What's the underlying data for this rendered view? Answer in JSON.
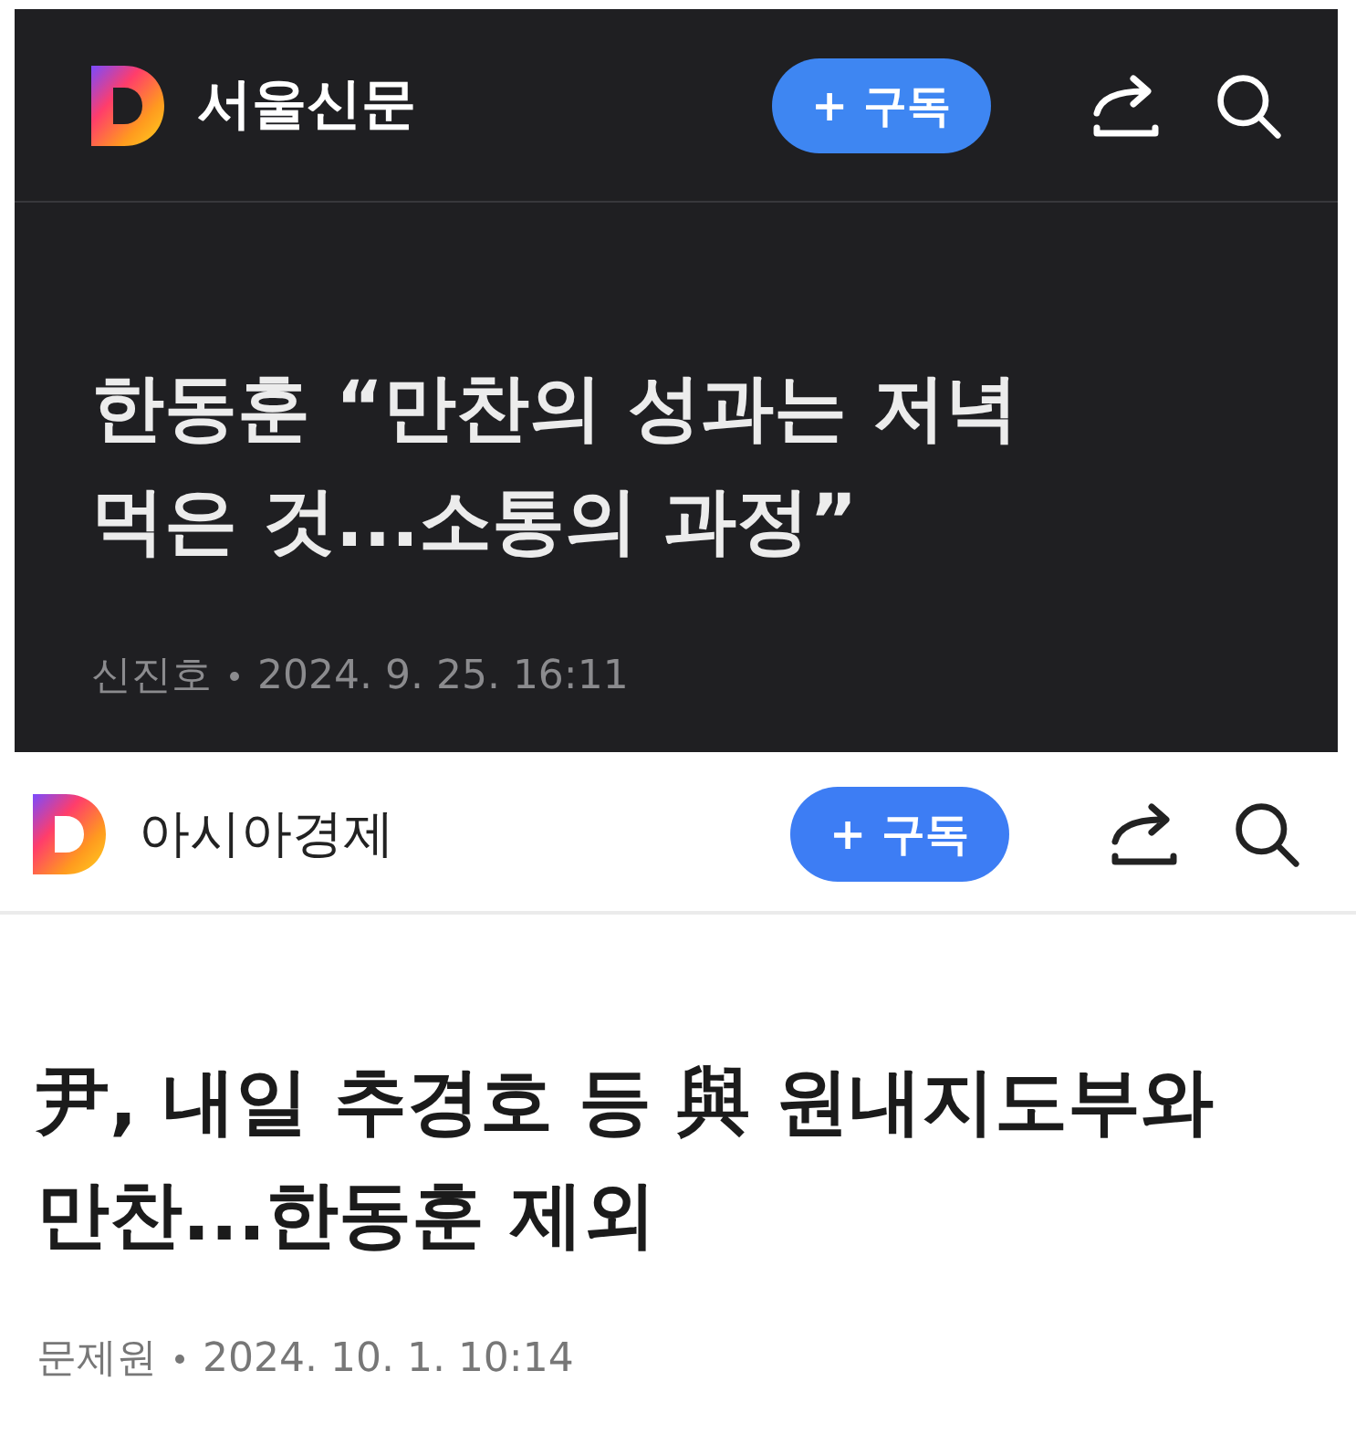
{
  "panels": [
    {
      "dark": true,
      "press": "서울신문",
      "subscribe": "+ 구독",
      "headline_lines": [
        "한동훈 “만찬의 성과는 저녁",
        "먹은 것...소통의 과정”"
      ],
      "author": "신진호",
      "date": "2024. 9. 25. 16:11"
    },
    {
      "dark": false,
      "press": "아시아경제",
      "subscribe": "+ 구독",
      "headline_lines": [
        "尹, 내일 추경호 등 與 원내지도부와",
        "만찬...한동훈 제외"
      ],
      "author": "문제원",
      "date": "2024. 10. 1. 10:14"
    }
  ]
}
